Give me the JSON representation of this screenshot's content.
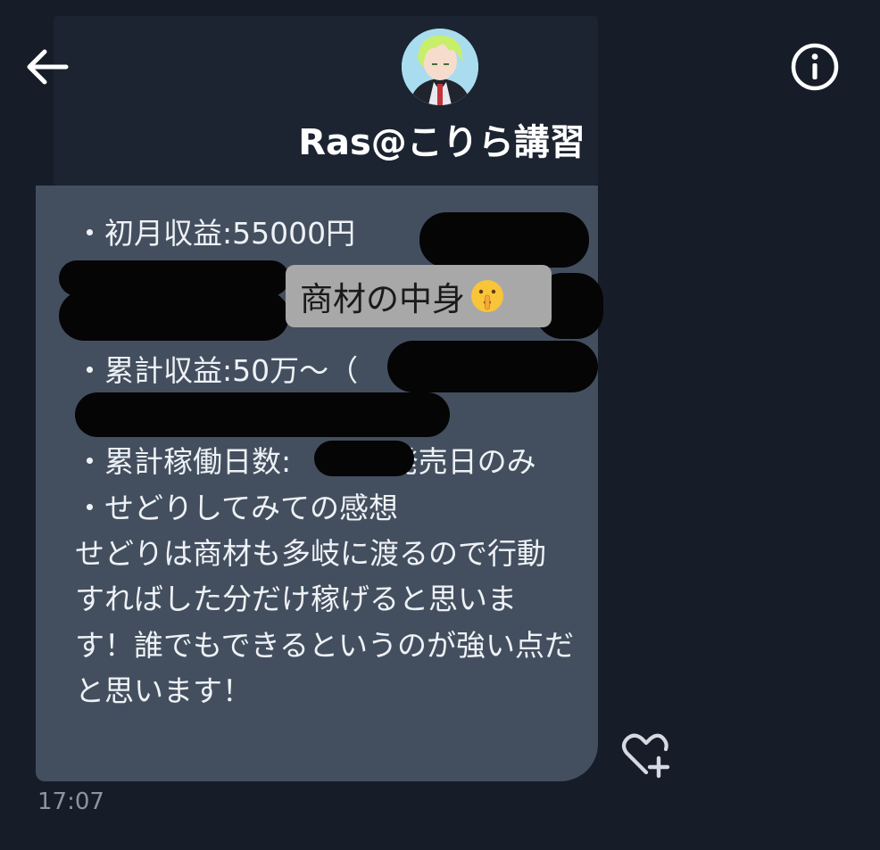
{
  "header": {
    "contact_name": "Ras@こりら講習",
    "back_icon": "arrow-left-icon",
    "info_icon": "info-circle-icon"
  },
  "message": {
    "text_lines": "・初月収益:55000円\n\n\n・累計収益:50万〜（\n\n・累計稼働日数:　　　 発売日のみ\n・せどりしてみての感想\nせどりは商材も多岐に渡るので行動すればした分だけ稼げると思います！誰でもできるというのが強い点だと思います！",
    "overlay_label": "商材の中身",
    "overlay_emoji": "shushing-face-emoji",
    "time": "17:07"
  },
  "reactions": {
    "add_reaction_icon": "heart-plus-icon"
  },
  "colors": {
    "background": "#161d28",
    "bubble": "#434f5f",
    "redaction": "#050505",
    "label_box": "#a8a8a8"
  }
}
